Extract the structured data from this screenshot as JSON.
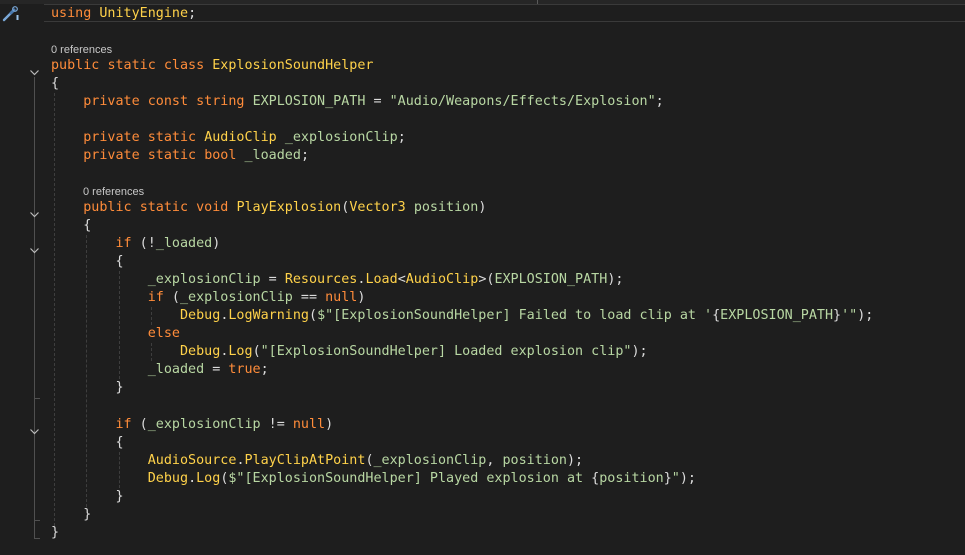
{
  "editor": {
    "language": "C#",
    "colors": {
      "background": "#1e1e1e",
      "keyword": "#ff8c3a",
      "type": "#ffd24a",
      "identifier": "#b8d7a3",
      "string": "#b8d7a3",
      "punctuation": "#dcdcdc",
      "codelens": "#c8c8c8"
    },
    "gutter_icons": [
      "quick-actions-icon"
    ],
    "codelens": {
      "class_references": "0 references",
      "method_references": "0 references"
    },
    "lines": [
      [
        [
          "kw",
          "using"
        ],
        [
          "pn",
          " "
        ],
        [
          "type",
          "UnityEngine"
        ],
        [
          "pn",
          ";"
        ]
      ],
      [
        [
          "kw",
          "public"
        ],
        [
          "pn",
          " "
        ],
        [
          "kw",
          "static"
        ],
        [
          "pn",
          " "
        ],
        [
          "kw",
          "class"
        ],
        [
          "pn",
          " "
        ],
        [
          "type",
          "ExplosionSoundHelper"
        ]
      ],
      [
        [
          "pn",
          "{"
        ]
      ],
      [
        [
          "pn",
          "    "
        ],
        [
          "kw",
          "private"
        ],
        [
          "pn",
          " "
        ],
        [
          "kw",
          "const"
        ],
        [
          "pn",
          " "
        ],
        [
          "kw",
          "string"
        ],
        [
          "pn",
          " "
        ],
        [
          "id",
          "EXPLOSION_PATH"
        ],
        [
          "pn",
          " = "
        ],
        [
          "str",
          "\"Audio/Weapons/Effects/Explosion\""
        ],
        [
          "pn",
          ";"
        ]
      ],
      [],
      [
        [
          "pn",
          "    "
        ],
        [
          "kw",
          "private"
        ],
        [
          "pn",
          " "
        ],
        [
          "kw",
          "static"
        ],
        [
          "pn",
          " "
        ],
        [
          "type",
          "AudioClip"
        ],
        [
          "pn",
          " "
        ],
        [
          "id",
          "_explosionClip"
        ],
        [
          "pn",
          ";"
        ]
      ],
      [
        [
          "pn",
          "    "
        ],
        [
          "kw",
          "private"
        ],
        [
          "pn",
          " "
        ],
        [
          "kw",
          "static"
        ],
        [
          "pn",
          " "
        ],
        [
          "kw",
          "bool"
        ],
        [
          "pn",
          " "
        ],
        [
          "id",
          "_loaded"
        ],
        [
          "pn",
          ";"
        ]
      ],
      [
        [
          "pn",
          "    "
        ],
        [
          "kw",
          "public"
        ],
        [
          "pn",
          " "
        ],
        [
          "kw",
          "static"
        ],
        [
          "pn",
          " "
        ],
        [
          "kw",
          "void"
        ],
        [
          "pn",
          " "
        ],
        [
          "fn",
          "PlayExplosion"
        ],
        [
          "pn",
          "("
        ],
        [
          "type",
          "Vector3"
        ],
        [
          "pn",
          " "
        ],
        [
          "id",
          "position"
        ],
        [
          "pn",
          ")"
        ]
      ],
      [
        [
          "pn",
          "    {"
        ]
      ],
      [
        [
          "pn",
          "        "
        ],
        [
          "kw",
          "if"
        ],
        [
          "pn",
          " (!"
        ],
        [
          "id",
          "_loaded"
        ],
        [
          "pn",
          ")"
        ]
      ],
      [
        [
          "pn",
          "        {"
        ]
      ],
      [
        [
          "pn",
          "            "
        ],
        [
          "id",
          "_explosionClip"
        ],
        [
          "pn",
          " = "
        ],
        [
          "type",
          "Resources"
        ],
        [
          "pn",
          "."
        ],
        [
          "fn",
          "Load"
        ],
        [
          "pn",
          "<"
        ],
        [
          "type",
          "AudioClip"
        ],
        [
          "pn",
          ">("
        ],
        [
          "id",
          "EXPLOSION_PATH"
        ],
        [
          "pn",
          ");"
        ]
      ],
      [
        [
          "pn",
          "            "
        ],
        [
          "kw",
          "if"
        ],
        [
          "pn",
          " ("
        ],
        [
          "id",
          "_explosionClip"
        ],
        [
          "pn",
          " == "
        ],
        [
          "kw",
          "null"
        ],
        [
          "pn",
          ")"
        ]
      ],
      [
        [
          "pn",
          "                "
        ],
        [
          "type",
          "Debug"
        ],
        [
          "pn",
          "."
        ],
        [
          "fn",
          "LogWarning"
        ],
        [
          "pn",
          "("
        ],
        [
          "str",
          "$\"[ExplosionSoundHelper] Failed to load clip at '"
        ],
        [
          "pn",
          "{"
        ],
        [
          "id",
          "EXPLOSION_PATH"
        ],
        [
          "pn",
          "}"
        ],
        [
          "str",
          "'\""
        ],
        [
          "pn",
          ");"
        ]
      ],
      [
        [
          "pn",
          "            "
        ],
        [
          "kw",
          "else"
        ]
      ],
      [
        [
          "pn",
          "                "
        ],
        [
          "type",
          "Debug"
        ],
        [
          "pn",
          "."
        ],
        [
          "fn",
          "Log"
        ],
        [
          "pn",
          "("
        ],
        [
          "str",
          "\"[ExplosionSoundHelper] Loaded explosion clip\""
        ],
        [
          "pn",
          ");"
        ]
      ],
      [
        [
          "pn",
          "            "
        ],
        [
          "id",
          "_loaded"
        ],
        [
          "pn",
          " = "
        ],
        [
          "kw",
          "true"
        ],
        [
          "pn",
          ";"
        ]
      ],
      [
        [
          "pn",
          "        }"
        ]
      ],
      [],
      [
        [
          "pn",
          "        "
        ],
        [
          "kw",
          "if"
        ],
        [
          "pn",
          " ("
        ],
        [
          "id",
          "_explosionClip"
        ],
        [
          "pn",
          " != "
        ],
        [
          "kw",
          "null"
        ],
        [
          "pn",
          ")"
        ]
      ],
      [
        [
          "pn",
          "        {"
        ]
      ],
      [
        [
          "pn",
          "            "
        ],
        [
          "type",
          "AudioSource"
        ],
        [
          "pn",
          "."
        ],
        [
          "fn",
          "PlayClipAtPoint"
        ],
        [
          "pn",
          "("
        ],
        [
          "id",
          "_explosionClip"
        ],
        [
          "pn",
          ", "
        ],
        [
          "id",
          "position"
        ],
        [
          "pn",
          ");"
        ]
      ],
      [
        [
          "pn",
          "            "
        ],
        [
          "type",
          "Debug"
        ],
        [
          "pn",
          "."
        ],
        [
          "fn",
          "Log"
        ],
        [
          "pn",
          "("
        ],
        [
          "str",
          "$\"[ExplosionSoundHelper] Played explosion at "
        ],
        [
          "pn",
          "{"
        ],
        [
          "id",
          "position"
        ],
        [
          "pn",
          "}"
        ],
        [
          "str",
          "\""
        ],
        [
          "pn",
          ");"
        ]
      ],
      [
        [
          "pn",
          "        }"
        ]
      ],
      [
        [
          "pn",
          "    }"
        ]
      ],
      [
        [
          "pn",
          "}"
        ]
      ]
    ]
  }
}
